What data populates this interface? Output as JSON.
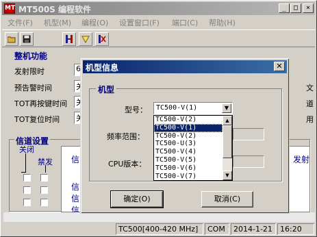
{
  "app": {
    "icon_text": "MT",
    "title": "MT500S 编程软件",
    "min_glyph": "_",
    "max_glyph": "□",
    "close_glyph": "×"
  },
  "menu": [
    "文件(F)",
    "机型(M)",
    "编程(O)",
    "设置窗口(F)",
    "端口(C)",
    "帮助(H)"
  ],
  "toolbar": {
    "icons": [
      "open-folder-icon",
      "save-disk-icon",
      "read-radio-icon",
      "write-radio-icon",
      "exit-icon"
    ]
  },
  "main_panel": {
    "title": "整机功能",
    "rows": [
      {
        "label": "发射限时",
        "value": "6"
      },
      {
        "label": "预告警时间",
        "value": "关"
      },
      {
        "label": "TOT再按键时间",
        "value": "关"
      },
      {
        "label": "TOT复位时间",
        "value": "关"
      }
    ],
    "right_fragments": [
      "文",
      "道",
      "用"
    ]
  },
  "channel_panel": {
    "title": "信道设置",
    "close_label": "关闭",
    "ban_label": "禁发",
    "grid_cells": [
      "信",
      "信",
      "信",
      "信"
    ],
    "right_header": "发射"
  },
  "status": [
    "TC500[400-420 MHz]",
    "COM 1",
    "2014-1-21",
    "16:20"
  ],
  "dialog": {
    "title": "机型信息",
    "close_glyph": "✕",
    "group_title": "机型",
    "model_label": "型号：",
    "model_value": "TC500-V(1)",
    "freq_label": "频率范围：",
    "cpu_label": "CPU版本：",
    "options": [
      {
        "text": "TC500-V(2)",
        "selected": false
      },
      {
        "text": "TC500-V(1)",
        "selected": true
      },
      {
        "text": "TC500-V(2)",
        "selected": false
      },
      {
        "text": "TC500-U(3)",
        "selected": false
      },
      {
        "text": "TC500-V(4)",
        "selected": false
      },
      {
        "text": "TC500-V(5)",
        "selected": false
      },
      {
        "text": "TC500-V(6)",
        "selected": false
      },
      {
        "text": "TC500-V(7)",
        "selected": false
      }
    ],
    "ok_label": "确定(O)",
    "cancel_label": "取消(C)"
  }
}
